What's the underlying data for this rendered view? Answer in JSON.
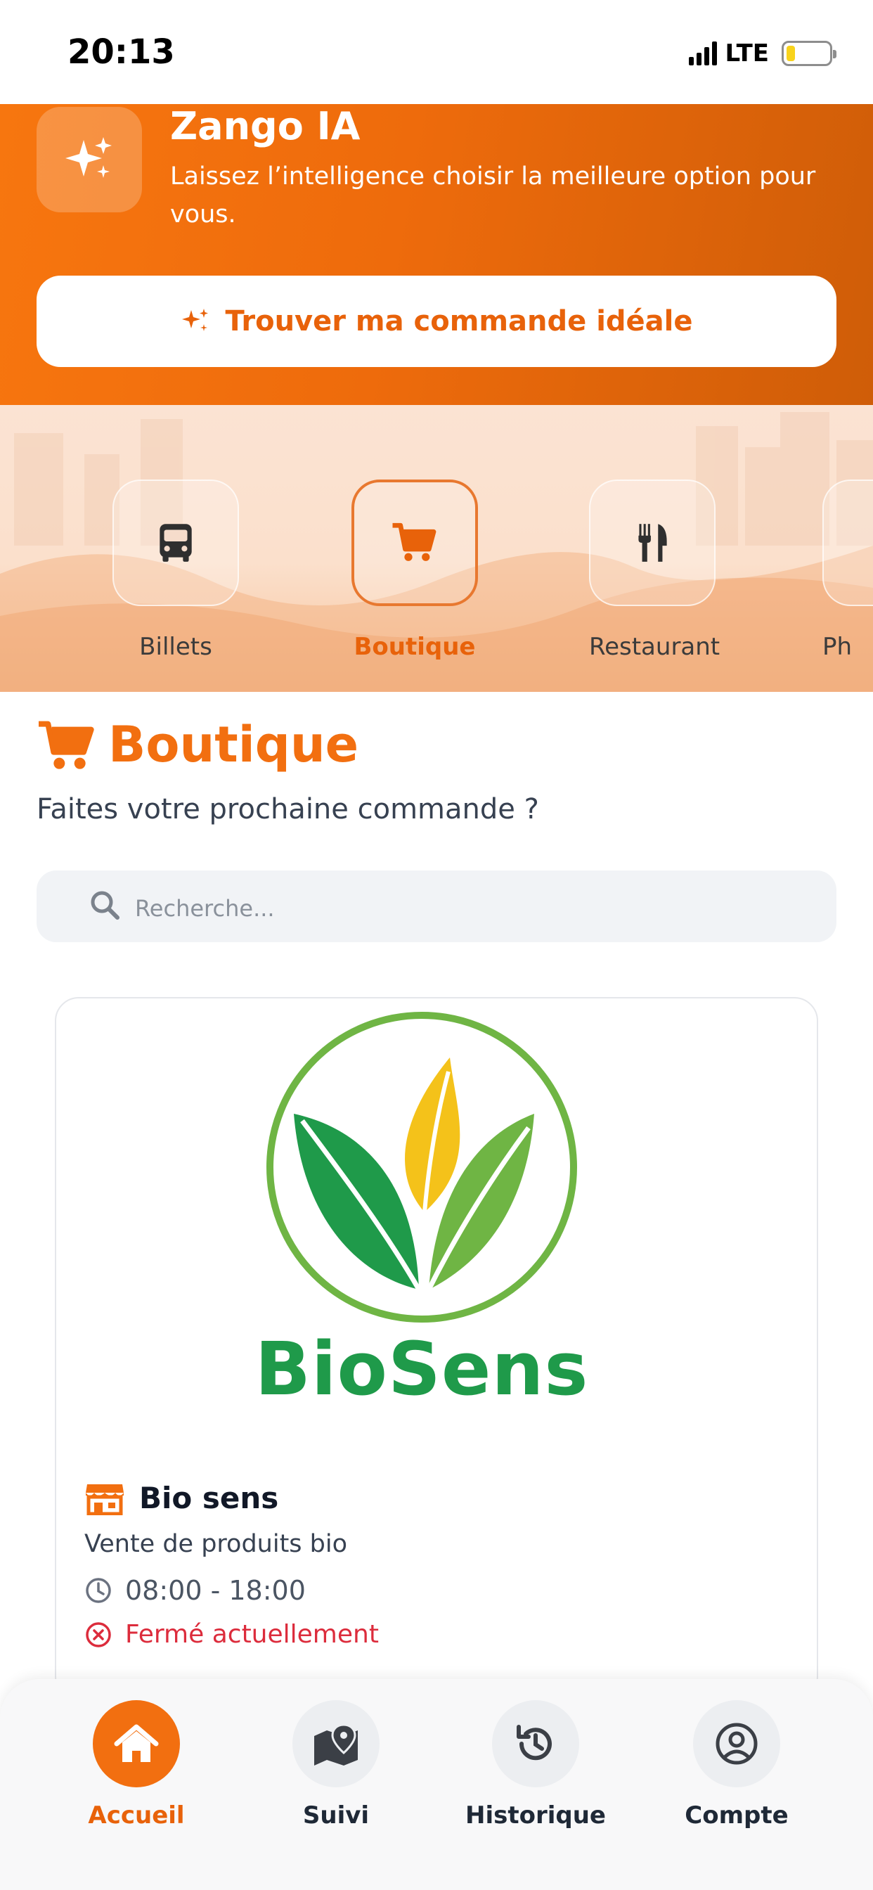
{
  "status_bar": {
    "time": "20:13",
    "network": "LTE"
  },
  "ai_banner": {
    "title": "Zango IA",
    "subtitle": "Laissez l’intelligence choisir la meilleure option pour vous.",
    "button_label": "Trouver ma commande idéale",
    "icon": "sparkles-icon"
  },
  "categories": [
    {
      "label": "Billets",
      "icon": "bus-icon",
      "active": false
    },
    {
      "label": "Boutique",
      "icon": "cart-icon",
      "active": true
    },
    {
      "label": "Restaurant",
      "icon": "utensils-icon",
      "active": false
    },
    {
      "label": "Ph",
      "icon": "pharmacy-icon",
      "active": false
    }
  ],
  "section": {
    "title": "Boutique",
    "subtitle": "Faites votre prochaine commande ?"
  },
  "search": {
    "placeholder": "Recherche..."
  },
  "shop": {
    "logo_text": "BioSens",
    "name": "Bio sens",
    "description": "Vente de produits bio",
    "hours": "08:00 - 18:00",
    "status": "Fermé actuellement"
  },
  "nav": [
    {
      "label": "Accueil",
      "icon": "home-icon",
      "active": true
    },
    {
      "label": "Suivi",
      "icon": "map-pin-icon",
      "active": false
    },
    {
      "label": "Historique",
      "icon": "history-icon",
      "active": false
    },
    {
      "label": "Compte",
      "icon": "user-icon",
      "active": false
    }
  ],
  "colors": {
    "accent": "#f26f10",
    "danger": "#dc2c3c",
    "brand_green": "#1f9a4a"
  }
}
